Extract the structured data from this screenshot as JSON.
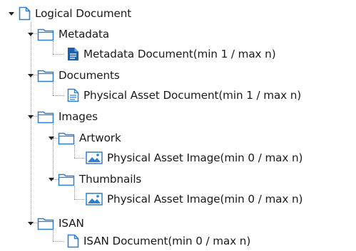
{
  "tree": {
    "root": {
      "label": "Logical Document",
      "icon": "document-outline-icon"
    },
    "metadata": {
      "label": "Metadata",
      "child": {
        "label": "Metadata Document(min 1 / max n)",
        "icon": "filled-document-icon"
      }
    },
    "documents": {
      "label": "Documents",
      "child": {
        "label": "Physical Asset Document(min 1 / max n)",
        "icon": "lined-document-icon"
      }
    },
    "images": {
      "label": "Images",
      "artwork": {
        "label": "Artwork",
        "child": {
          "label": "Physical Asset Image(min 0 / max n)",
          "icon": "image-icon"
        }
      },
      "thumbnails": {
        "label": "Thumbnails",
        "child": {
          "label": "Physical Asset Image(min 0 / max n)",
          "icon": "image-icon"
        }
      }
    },
    "isan": {
      "label": "ISAN",
      "child": {
        "label": "ISAN Document(min 0 / max n)",
        "icon": "document-outline-icon"
      }
    }
  },
  "colors": {
    "icon_blue": "#2f7fd0",
    "icon_dark_blue": "#1d5fa8",
    "connector": "#9a9a9a"
  }
}
